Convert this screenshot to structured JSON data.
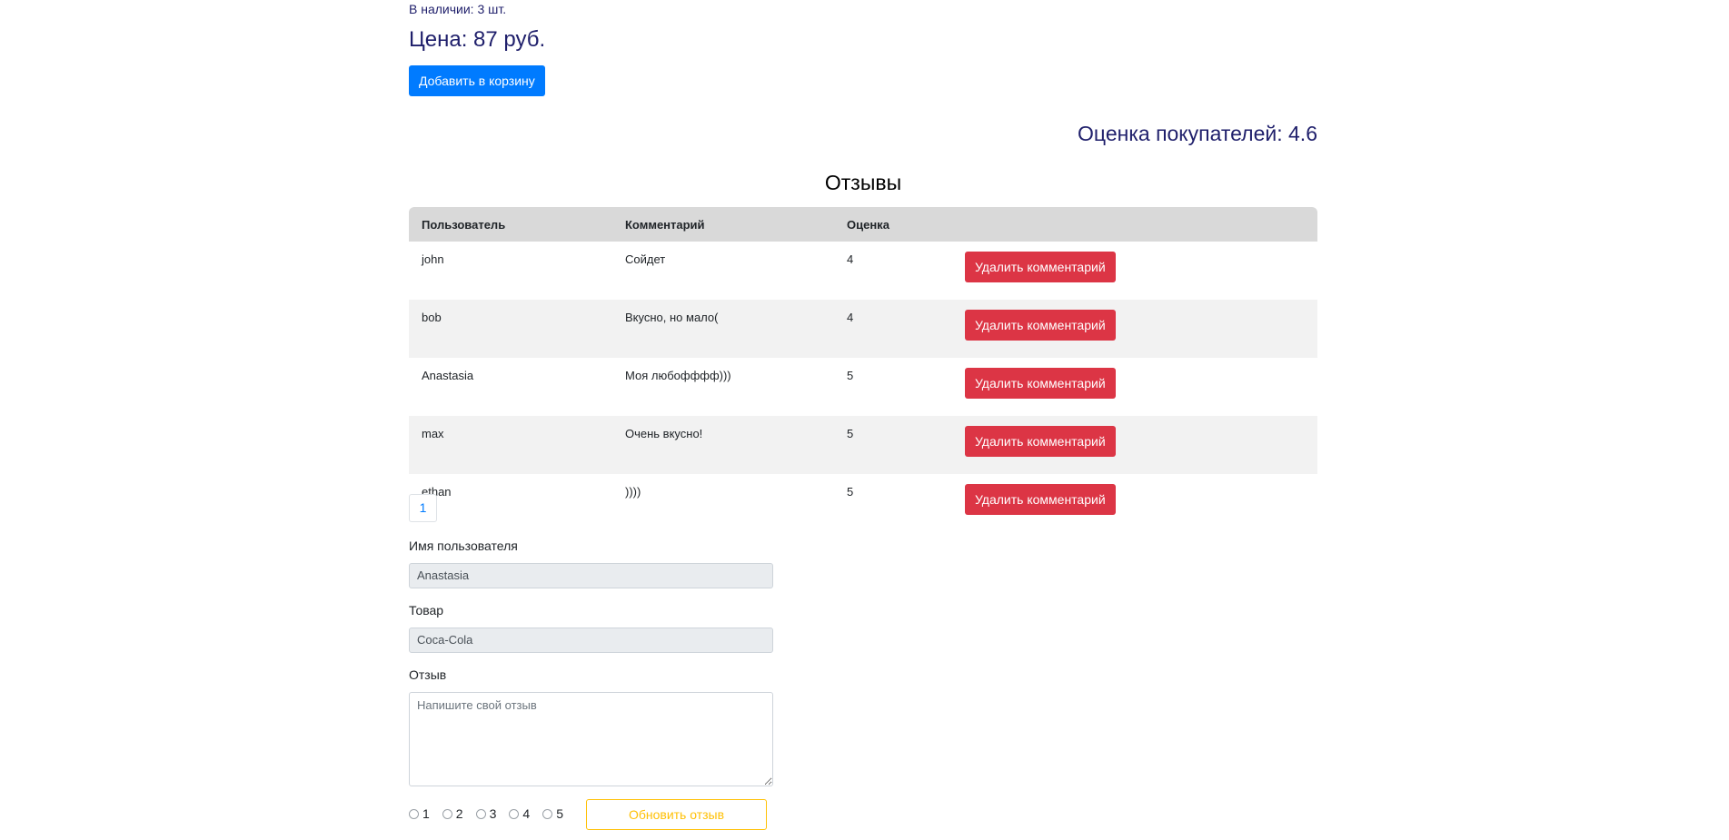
{
  "product": {
    "stock_text": "В наличии: 3 шт.",
    "price_text": "Цена: 87 руб.",
    "add_to_cart_label": "Добавить в корзину",
    "rating_text": "Оценка покупателей: 4.6"
  },
  "reviews": {
    "title": "Отзывы",
    "columns": [
      "Пользователь",
      "Комментарий",
      "Оценка"
    ],
    "delete_label": "Удалить комментарий",
    "rows": [
      {
        "user": "john",
        "comment": "Сойдет",
        "grade": "4"
      },
      {
        "user": "bob",
        "comment": "Вкусно, но мало(",
        "grade": "4"
      },
      {
        "user": "Anastasia",
        "comment": "Моя любофффф)))",
        "grade": "5"
      },
      {
        "user": "max",
        "comment": "Очень вкусно!",
        "grade": "5"
      },
      {
        "user": "ethan",
        "comment": "))))",
        "grade": "5"
      }
    ]
  },
  "pagination": {
    "current_page": "1"
  },
  "form": {
    "username_label": "Имя пользователя",
    "username_value": "Anastasia",
    "product_label": "Товар",
    "product_value": "Coca-Cola",
    "review_label": "Отзыв",
    "review_placeholder": "Напишите свой отзыв",
    "grade_options": [
      "1",
      "2",
      "3",
      "4",
      "5"
    ],
    "update_label": "Обновить отзыв"
  },
  "colors": {
    "primary": "#007bff",
    "danger": "#dc3545",
    "warning": "#ffc107",
    "heading": "#1f1f6b"
  }
}
